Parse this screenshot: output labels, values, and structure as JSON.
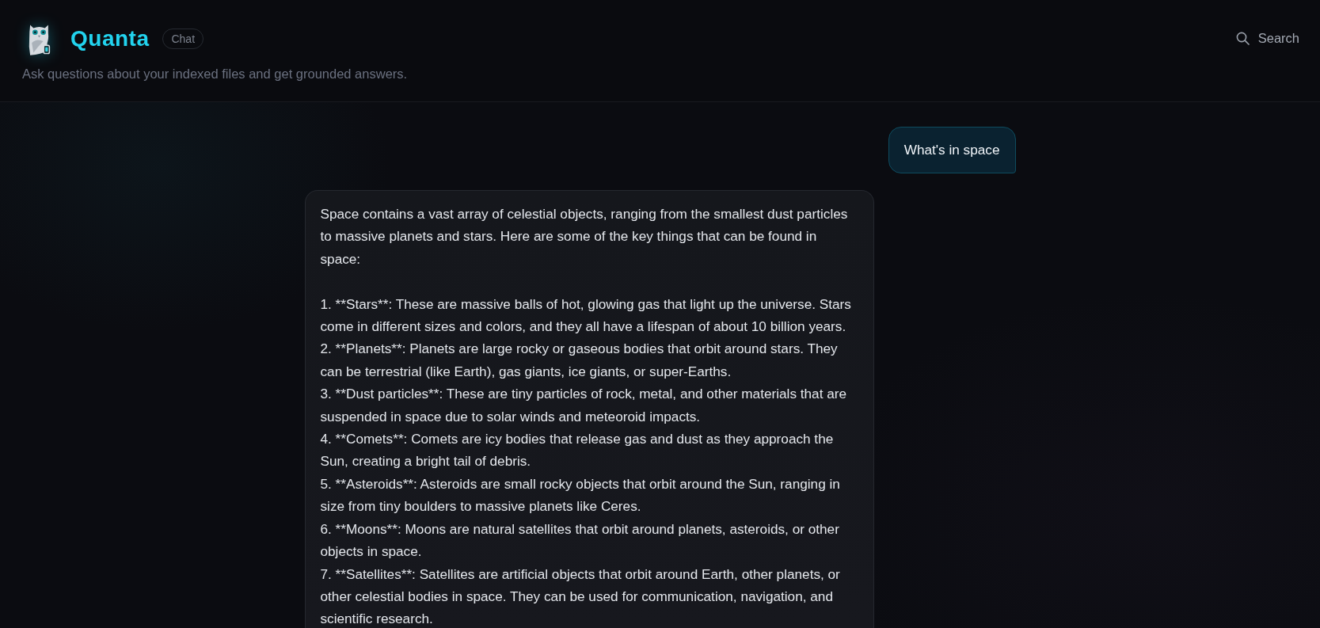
{
  "header": {
    "app_name": "Quanta",
    "badge": "Chat",
    "subtitle": "Ask questions about your indexed files and get grounded answers.",
    "search_label": "Search"
  },
  "messages": [
    {
      "kind": "user",
      "text": "What's in space"
    },
    {
      "kind": "assistant",
      "text": "Space contains a vast array of celestial objects, ranging from the smallest dust particles to massive planets and stars. Here are some of the key things that can be found in space:\n\n1. **Stars**: These are massive balls of hot, glowing gas that light up the universe. Stars come in different sizes and colors, and they all have a lifespan of about 10 billion years.\n2. **Planets**: Planets are large rocky or gaseous bodies that orbit around stars. They can be terrestrial (like Earth), gas giants, ice giants, or super-Earths.\n3. **Dust particles**: These are tiny particles of rock, metal, and other materials that are suspended in space due to solar winds and meteoroid impacts.\n4. **Comets**: Comets are icy bodies that release gas and dust as they approach the Sun, creating a bright tail of debris.\n5. **Asteroids**: Asteroids are small rocky objects that orbit around the Sun, ranging in size from tiny boulders to massive planets like Ceres.\n6. **Moons**: Moons are natural satellites that orbit around planets, asteroids, or other objects in space.\n7. **Satellites**: Satellites are artificial objects that orbit around Earth, other planets, or other celestial bodies in space. They can be used for communication, navigation, and scientific research."
    }
  ]
}
